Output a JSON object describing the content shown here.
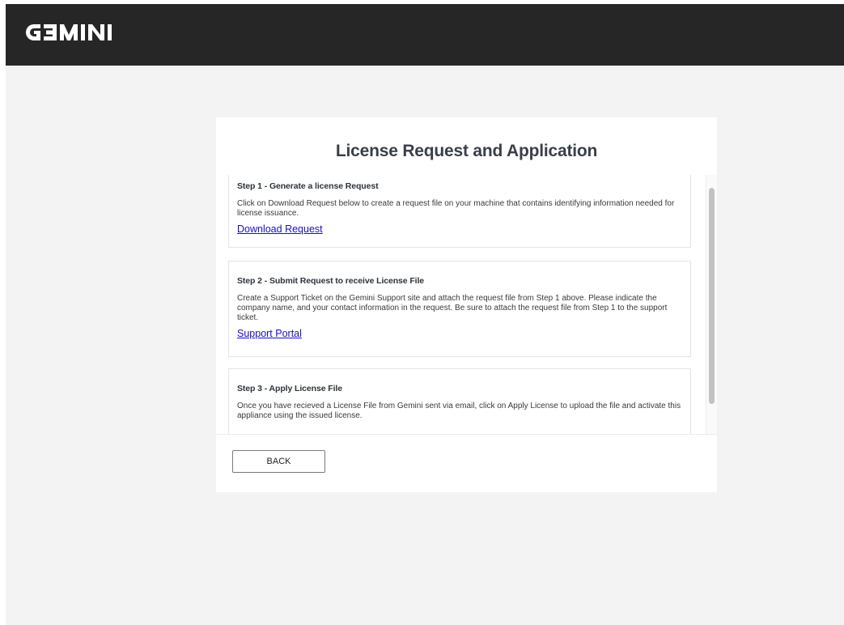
{
  "header": {
    "logo_text": "GEMINI"
  },
  "card": {
    "title": "License Request and Application",
    "steps": [
      {
        "heading": "Step 1 - Generate a license Request",
        "text": "Click on Download Request below to create a request file on your machine that contains identifying information needed for license issuance.",
        "link": "Download Request"
      },
      {
        "heading": "Step 2 - Submit Request to receive License File",
        "text": "Create a Support Ticket on the Gemini Support site and attach the request file from Step 1 above. Please indicate the company name, and your contact information in the request. Be sure to attach the request file from Step 1 to the support ticket.",
        "link": "Support Portal"
      },
      {
        "heading": "Step 3 - Apply License File",
        "text": "Once you have recieved a License File from Gemini sent via email, click on Apply License to upload the file and activate this appliance using the issued license."
      }
    ],
    "back_label": "BACK"
  },
  "colors": {
    "topbar": "#262626",
    "background": "#f3f3f4",
    "link": "#1a0dcc",
    "title": "#3a3f47"
  }
}
